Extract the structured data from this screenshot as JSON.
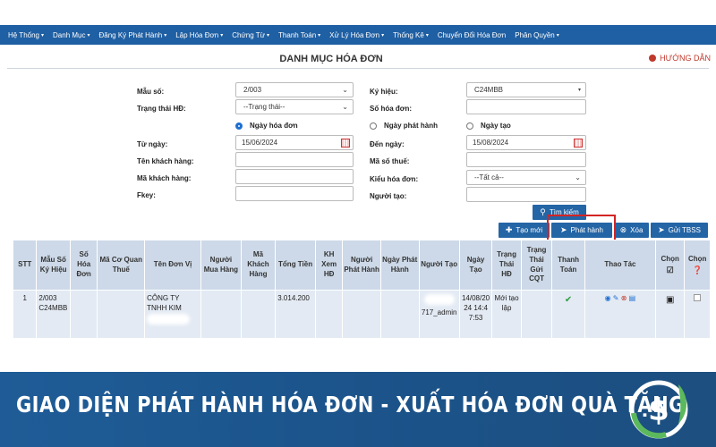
{
  "menu": [
    "Hệ Thống",
    "Danh Mục",
    "Đăng Ký Phát Hành",
    "Lập Hóa Đơn",
    "Chứng Từ",
    "Thanh Toán",
    "Xử Lý Hóa Đơn",
    "Thống Kê",
    "Chuyển Đổi Hóa Đơn",
    "Phân Quyền"
  ],
  "page_title": "DANH MỤC HÓA ĐƠN",
  "help_label": "HƯỚNG DẪN",
  "form": {
    "mau_so_label": "Mẫu số:",
    "mau_so_value": "2/003",
    "ky_hieu_label": "Ký hiệu:",
    "ky_hieu_value": "C24MBB",
    "trang_thai_label": "Trạng thái HĐ:",
    "trang_thai_value": "--Trạng thái--",
    "so_hoa_don_label": "Số hóa đơn:",
    "radio_ngay_hoa_don": "Ngày hóa đơn",
    "radio_ngay_phat_hanh": "Ngày phát hành",
    "radio_ngay_tao": "Ngày tạo",
    "tu_ngay_label": "Từ ngày:",
    "tu_ngay_value": "15/06/2024",
    "den_ngay_label": "Đến ngày:",
    "den_ngay_value": "15/08/2024",
    "ten_khach_hang_label": "Tên khách hàng:",
    "ma_so_thue_label": "Mã số thuế:",
    "ma_khach_hang_label": "Mã khách hàng:",
    "kieu_hoa_don_label": "Kiểu hóa đơn:",
    "kieu_hoa_don_value": "--Tất cả--",
    "fkey_label": "Fkey:",
    "nguoi_tao_label": "Người tạo:"
  },
  "buttons": {
    "tim_kiem": "Tìm kiếm",
    "tao_moi": "Tạo mới",
    "phat_hanh": "Phát hành",
    "xoa": "Xóa",
    "gui_tbss": "Gửi TBSS"
  },
  "table": {
    "headers": [
      "STT",
      "Mẫu Số Ký Hiệu",
      "Số Hóa Đơn",
      "Mã Cơ Quan Thuế",
      "Tên Đơn Vị",
      "Người Mua Hàng",
      "Mã Khách Hàng",
      "Tổng Tiền",
      "KH Xem HĐ",
      "Người Phát Hành",
      "Ngày Phát Hành",
      "Người Tạo",
      "Ngày Tạo",
      "Trạng Thái HĐ",
      "Trạng Thái Gửi CQT",
      "Thanh Toán",
      "Thao Tác",
      "Chọn",
      "Chọn"
    ],
    "row": {
      "stt": "1",
      "mau_so": "2/003 C24MBB",
      "ten_don_vi": "CÔNG TY TNHH KIM",
      "tong_tien": "3.014.200",
      "nguoi_tao": "717_admin",
      "ngay_tao": "14/08/2024 14:47:53",
      "trang_thai": "Mới tạo lập"
    }
  },
  "banner": "GIAO DIỆN PHÁT HÀNH HÓA ĐƠN - XUẤT HÓA ĐƠN QUÀ TẶNG",
  "colors": {
    "nav": "#1f5fa3",
    "button": "#2465a6",
    "highlight_box": "#d32424",
    "footer": "#1b5288"
  }
}
